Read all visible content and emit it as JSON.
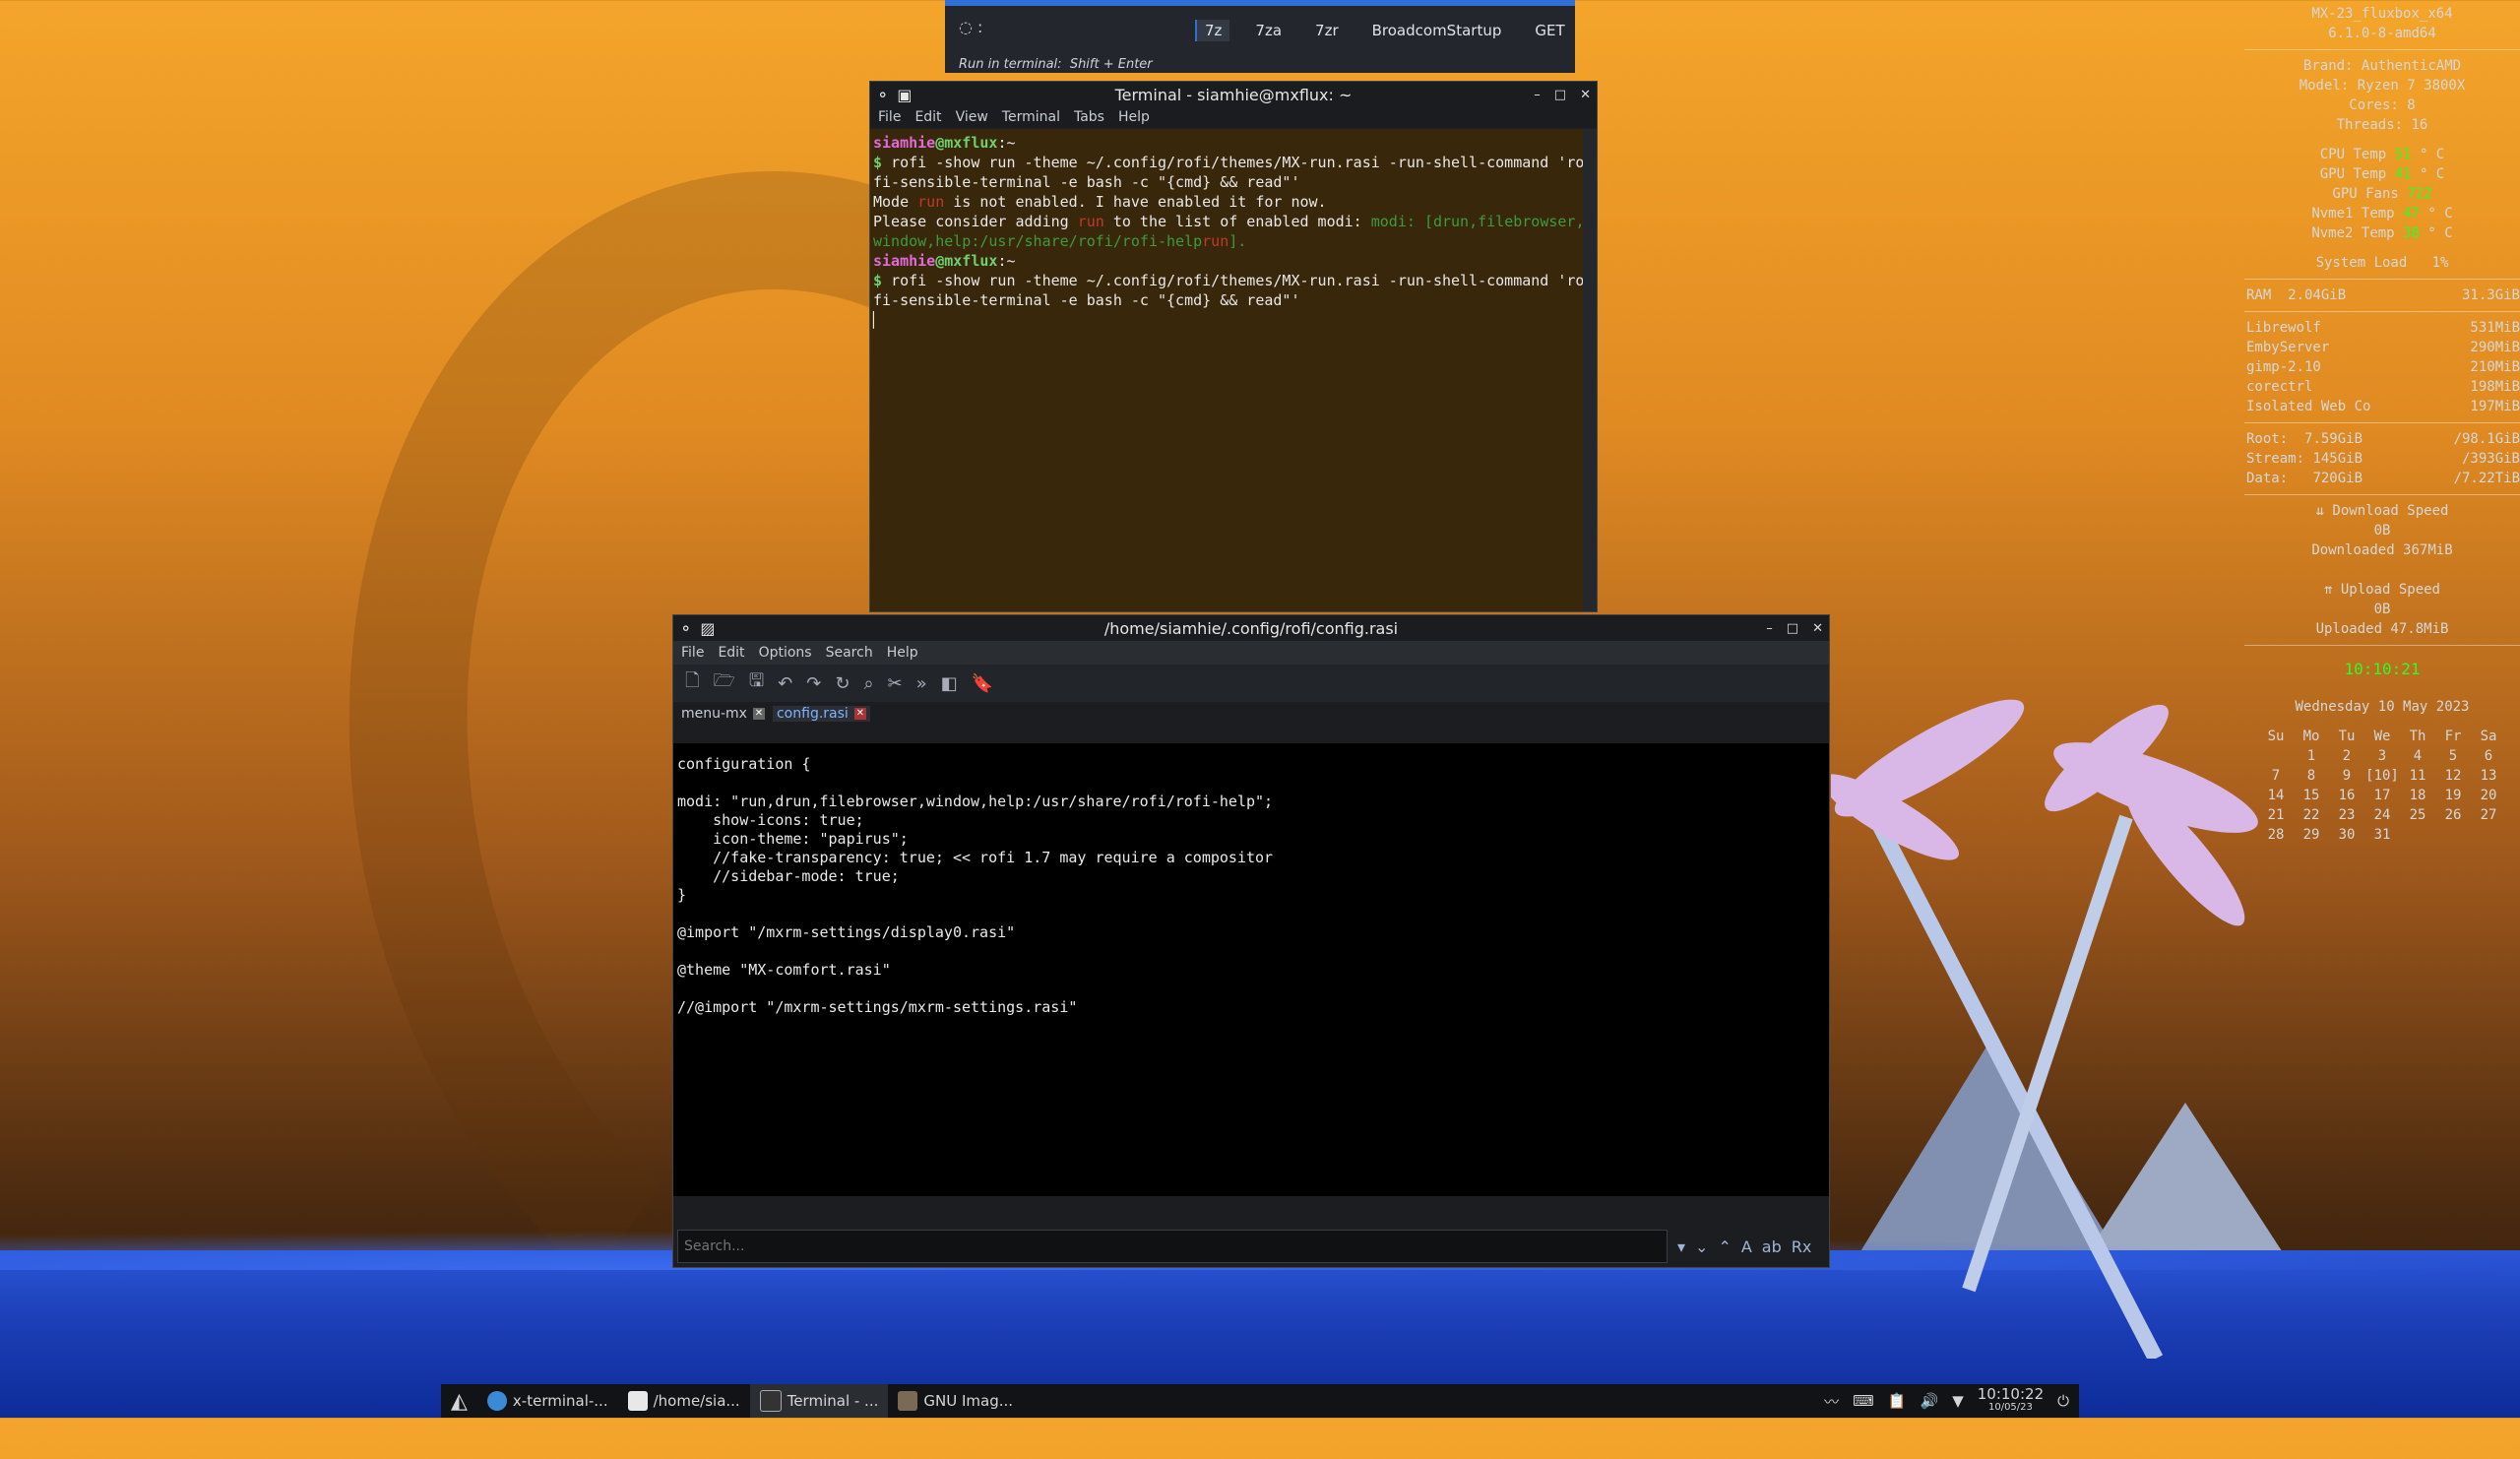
{
  "colors": {
    "accent": "#2f6fd6",
    "prompt_user": "#e06bd6",
    "prompt_host": "#6ed06e",
    "clock": "#2aff2a"
  },
  "rofi": {
    "prompt": ":",
    "items": [
      "7z",
      "7za",
      "7zr",
      "BroadcomStartup",
      "GET"
    ],
    "hint_label": "Run in terminal:",
    "hint_keys": "Shift + Enter"
  },
  "terminal": {
    "title": "Terminal - siamhie@mxflux: ~",
    "menu": [
      "File",
      "Edit",
      "View",
      "Terminal",
      "Tabs",
      "Help"
    ],
    "prompt_user": "siamhie",
    "prompt_at": "@",
    "prompt_host": "mxflux",
    "prompt_path": ":~",
    "cmd1": "rofi -show run -theme ~/.config/rofi/themes/MX-run.rasi -run-shell-command 'ro",
    "cmd1b": "fi-sensible-terminal -e bash -c \"{cmd} && read\"'",
    "msg_mode": "Mode",
    "msg_mode_name": "run",
    "msg_mode_rest": "is not enabled. I have enabled it for now.",
    "msg_add": "Please consider adding",
    "msg_add_name": "run",
    "msg_add_rest": "to the list of enabled modi:",
    "msg_modi_key": "modi:",
    "msg_modi_val": "[drun,filebrowser,",
    "msg_modi_line2": "window,help:/usr/share/rofi/rofi-help",
    "msg_modi_run": "run",
    "msg_modi_end": "].",
    "cmd2": "rofi -show run -theme ~/.config/rofi/themes/MX-run.rasi -run-shell-command 'ro",
    "cmd2b": "fi-sensible-terminal -e bash -c \"{cmd} && read\"'"
  },
  "editor": {
    "title": "/home/siamhie/.config/rofi/config.rasi",
    "menu": [
      "File",
      "Edit",
      "Options",
      "Search",
      "Help"
    ],
    "tabs": [
      {
        "label": "menu-mx",
        "active": false
      },
      {
        "label": "config.rasi",
        "active": true
      }
    ],
    "code": [
      "configuration {",
      "",
      "modi: \"run,drun,filebrowser,window,help:/usr/share/rofi/rofi-help\";",
      "    show-icons: true;",
      "    icon-theme: \"papirus\";",
      "    //fake-transparency: true; << rofi 1.7 may require a compositor",
      "    //sidebar-mode: true;",
      "}",
      "",
      "@import \"/mxrm-settings/display0.rasi\"",
      "",
      "@theme \"MX-comfort.rasi\"",
      "",
      "//@import \"/mxrm-settings/mxrm-settings.rasi\""
    ],
    "search_placeholder": "Search..."
  },
  "conky": {
    "distro": "MX-23_fluxbox_x64",
    "kernel": "6.1.0-8-amd64",
    "brand_label": "Brand:",
    "brand": "AuthenticAMD",
    "model_label": "Model:",
    "model": "Ryzen 7 3800X",
    "cores_label": "Cores:",
    "cores": "8",
    "threads_label": "Threads:",
    "threads": "16",
    "sensors": [
      {
        "label": "CPU Temp",
        "value": "51",
        "unit": "° C"
      },
      {
        "label": "GPU Temp",
        "value": "41",
        "unit": "° C"
      },
      {
        "label": "GPU Fans",
        "value": "722",
        "unit": ""
      },
      {
        "label": "Nvme1 Temp",
        "value": "47",
        "unit": "° C"
      },
      {
        "label": "Nvme2 Temp",
        "value": "38",
        "unit": "° C"
      }
    ],
    "load_label": "System Load",
    "load": "1%",
    "ram_label": "RAM",
    "ram_used": "2.04GiB",
    "ram_total": "31.3GiB",
    "procs": [
      {
        "name": "Librewolf",
        "mem": "531MiB"
      },
      {
        "name": "EmbyServer",
        "mem": "290MiB"
      },
      {
        "name": "gimp-2.10",
        "mem": "210MiB"
      },
      {
        "name": "corectrl",
        "mem": "198MiB"
      },
      {
        "name": "Isolated Web Co",
        "mem": "197MiB"
      }
    ],
    "disks": [
      {
        "label": "Root:",
        "used": "7.59GiB",
        "total": "/98.1GiB"
      },
      {
        "label": "Stream:",
        "used": "145GiB",
        "total": "/393GiB"
      },
      {
        "label": "Data:",
        "used": "720GiB",
        "total": "/7.22TiB"
      }
    ],
    "down_label": "⇊ Download Speed",
    "down_speed": "0B",
    "downloaded": "Downloaded 367MiB",
    "up_label": "⇈ Upload Speed",
    "up_speed": "0B",
    "uploaded": "Uploaded 47.8MiB",
    "time": "10:10:21",
    "date": "Wednesday 10 May 2023",
    "cal_head": [
      "Su",
      "Mo",
      "Tu",
      "We",
      "Th",
      "Fr",
      "Sa"
    ],
    "cal_days": [
      "",
      "1",
      "2",
      "3",
      "4",
      "5",
      "6",
      "7",
      "8",
      "9",
      "[10]",
      "11",
      "12",
      "13",
      "14",
      "15",
      "16",
      "17",
      "18",
      "19",
      "20",
      "21",
      "22",
      "23",
      "24",
      "25",
      "26",
      "27",
      "28",
      "29",
      "30",
      "31",
      "",
      "",
      ""
    ]
  },
  "taskbar": {
    "tasks": [
      {
        "label": "x-terminal-...",
        "icon": "terminal-icon"
      },
      {
        "label": "/home/sia...",
        "icon": "editor-icon"
      },
      {
        "label": "Terminal - ...",
        "icon": "terminal-icon"
      },
      {
        "label": "GNU Imag...",
        "icon": "gimp-icon"
      }
    ],
    "time": "10:10:22",
    "date": "10/05/23"
  }
}
